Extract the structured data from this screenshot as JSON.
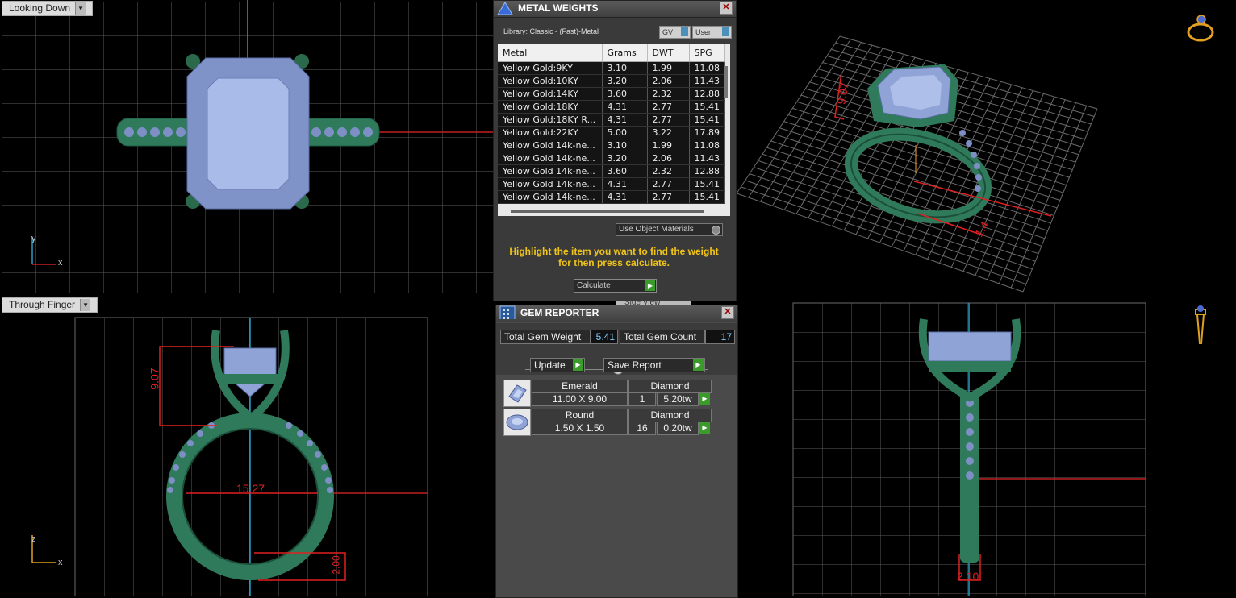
{
  "viewports": {
    "top_left_label": "Looking Down",
    "bottom_left_label": "Through Finger",
    "mid_hidden_label": "Side View",
    "axis_tl": {
      "y": "y",
      "x": "x"
    },
    "axis_bl": {
      "z": "z",
      "x": "x"
    },
    "dims": {
      "bl_height": "9.07",
      "bl_diameter": "15.27",
      "bl_band": "2.00",
      "br_width": "2.10",
      "tr_a": "9.07",
      "tr_b": "1.4"
    }
  },
  "metal_weights": {
    "title": "METAL WEIGHTS",
    "library": "Library: Classic - (Fast)-Metal",
    "toggle_gv": "GV",
    "toggle_user": "User",
    "columns": [
      "Metal",
      "Grams",
      "DWT",
      "SPG"
    ],
    "rows": [
      [
        "Yellow Gold:9KY",
        "3.10",
        "1.99",
        "11.08"
      ],
      [
        "Yellow Gold:10KY",
        "3.20",
        "2.06",
        "11.43"
      ],
      [
        "Yellow Gold:14KY",
        "3.60",
        "2.32",
        "12.88"
      ],
      [
        "Yellow Gold:18KY",
        "4.31",
        "2.77",
        "15.41"
      ],
      [
        "Yellow Gold:18KY R...",
        "4.31",
        "2.77",
        "15.41"
      ],
      [
        "Yellow Gold:22KY",
        "5.00",
        "3.22",
        "17.89"
      ],
      [
        "Yellow Gold 14k-ne...",
        "3.10",
        "1.99",
        "11.08"
      ],
      [
        "Yellow Gold 14k-ne...",
        "3.20",
        "2.06",
        "11.43"
      ],
      [
        "Yellow Gold 14k-ne...",
        "3.60",
        "2.32",
        "12.88"
      ],
      [
        "Yellow Gold 14k-ne...",
        "4.31",
        "2.77",
        "15.41"
      ],
      [
        "Yellow Gold 14k-ne...",
        "4.31",
        "2.77",
        "15.41"
      ]
    ],
    "use_object_materials": "Use Object Materials",
    "hint": "Highlight the item you want to find the weight for then press calculate.",
    "calculate_label": "Calculate"
  },
  "gem_reporter": {
    "title": "GEM REPORTER",
    "total_weight_label": "Total Gem Weight",
    "total_weight": "5.41",
    "total_count_label": "Total Gem Count",
    "total_count": "17",
    "update_label": "Update",
    "save_report_label": "Save Report",
    "gems": [
      {
        "cut": "Emerald",
        "type": "Diamond",
        "size": "11.00 X 9.00",
        "qty": "1",
        "weight": "5.20tw"
      },
      {
        "cut": "Round",
        "type": "Diamond",
        "size": "1.50 X 1.50",
        "qty": "16",
        "weight": "0.20tw"
      }
    ]
  },
  "colors": {
    "metal": "#2e7a5a",
    "stone": "#8fa3d6",
    "grid": "#5a5a5a",
    "dim": "#e02020",
    "axis": "#2a9bbf",
    "hint": "#f0c419"
  }
}
